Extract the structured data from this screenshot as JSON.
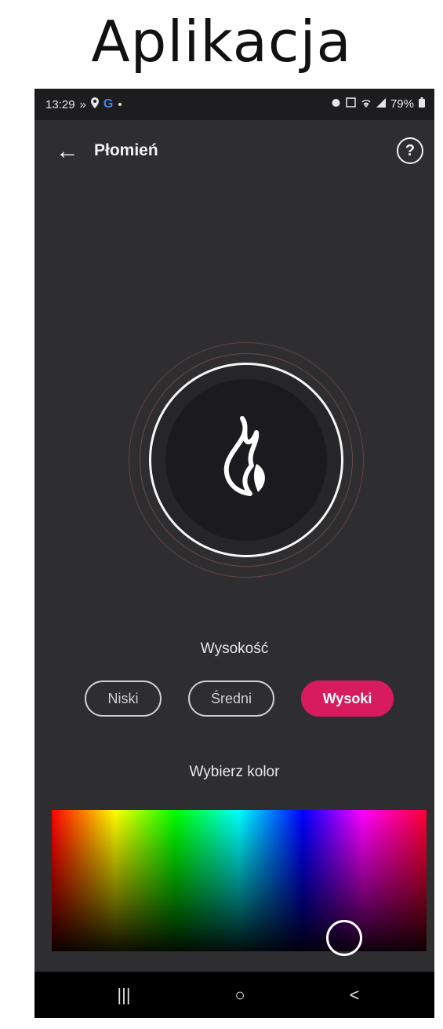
{
  "heading": "Aplikacja",
  "status_bar": {
    "time": "13:29",
    "left_icons": [
      "signal-forward-icon",
      "location-icon",
      "google-icon",
      "dot-icon"
    ],
    "battery": "79%",
    "right_icons": [
      "alarm-icon",
      "nfc-icon",
      "wifi-icon",
      "cellular-icon",
      "battery-icon"
    ]
  },
  "app_bar": {
    "title": "Płomień",
    "back_icon": "arrow-left-icon",
    "help_icon": "help-icon"
  },
  "flame": {
    "icon": "flame-icon"
  },
  "height_section": {
    "label": "Wysokość",
    "options": [
      "Niski",
      "Średni",
      "Wysoki"
    ],
    "selected": "Wysoki"
  },
  "color_section": {
    "label": "Wybierz kolor"
  },
  "colors": {
    "accent": "#d81b5c",
    "background": "#2e2e31"
  },
  "nav_bar": {
    "recents": "|||",
    "home": "○",
    "back": "<"
  }
}
